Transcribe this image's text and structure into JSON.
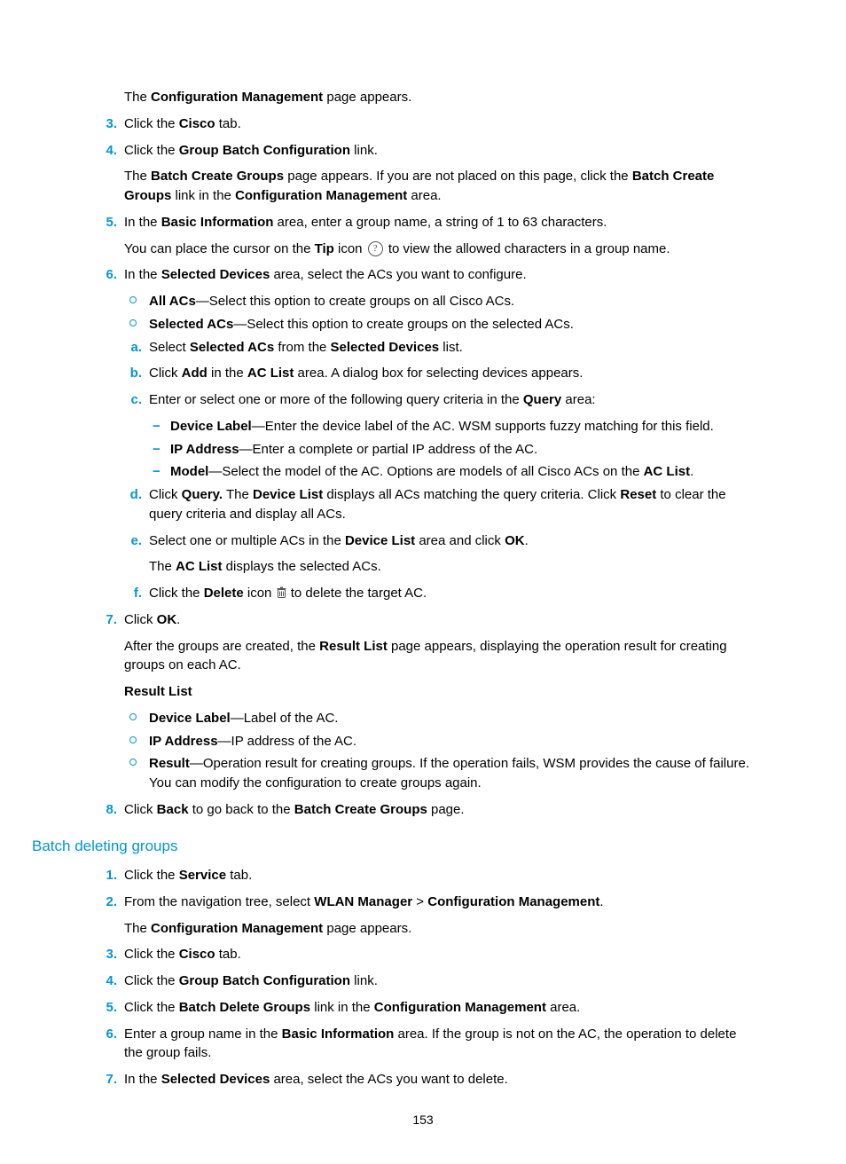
{
  "page_number": "153",
  "sections": {
    "first": {
      "pre_text": {
        "prefix": "The ",
        "bold": "Configuration Management",
        "suffix": " page appears."
      },
      "steps": {
        "3": {
          "line": [
            {
              "t": "Click the "
            },
            {
              "b": "Cisco"
            },
            {
              "t": " tab."
            }
          ]
        },
        "4": {
          "line": [
            {
              "t": "Click the "
            },
            {
              "b": "Group Batch Configuration"
            },
            {
              "t": " link."
            }
          ],
          "para": [
            {
              "t": "The "
            },
            {
              "b": "Batch Create Groups"
            },
            {
              "t": " page appears. If you are not placed on this page, click the "
            },
            {
              "b": "Batch Create Groups"
            },
            {
              "t": " link in the "
            },
            {
              "b": "Configuration Management"
            },
            {
              "t": " area."
            }
          ]
        },
        "5": {
          "line": [
            {
              "t": "In the "
            },
            {
              "b": "Basic Information"
            },
            {
              "t": " area, enter a group name, a string of 1 to 63 characters."
            }
          ],
          "para": [
            {
              "t": "You can place the cursor on the "
            },
            {
              "b": "Tip"
            },
            {
              "t": " icon "
            },
            {
              "icon": "tip"
            },
            {
              "t": " to view the allowed characters in a group name."
            }
          ]
        },
        "6": {
          "line": [
            {
              "t": "In the "
            },
            {
              "b": "Selected Devices"
            },
            {
              "t": " area, select the ACs you want to configure."
            }
          ],
          "circles": [
            [
              {
                "b": "All ACs"
              },
              {
                "t": "—Select this option to create groups on all Cisco ACs."
              }
            ],
            [
              {
                "b": "Selected ACs"
              },
              {
                "t": "—Select this option to create groups on the selected ACs."
              }
            ]
          ],
          "alpha": {
            "a": {
              "line": [
                {
                  "t": "Select "
                },
                {
                  "b": "Selected ACs"
                },
                {
                  "t": " from the "
                },
                {
                  "b": "Selected Devices"
                },
                {
                  "t": " list."
                }
              ]
            },
            "b": {
              "line": [
                {
                  "t": "Click "
                },
                {
                  "b": "Add"
                },
                {
                  "t": " in the "
                },
                {
                  "b": "AC List"
                },
                {
                  "t": " area. A dialog box for selecting devices appears."
                }
              ]
            },
            "c": {
              "line": [
                {
                  "t": "Enter or select one or more of the following query criteria in the "
                },
                {
                  "b": "Query"
                },
                {
                  "t": " area:"
                }
              ],
              "dash": [
                [
                  {
                    "b": "Device Label"
                  },
                  {
                    "t": "—Enter the device label of the AC. WSM supports fuzzy matching for this field."
                  }
                ],
                [
                  {
                    "b": "IP Address"
                  },
                  {
                    "t": "—Enter a complete or partial IP address of the AC."
                  }
                ],
                [
                  {
                    "b": "Model"
                  },
                  {
                    "t": "—Select the model of the AC. Options are models of all Cisco ACs on the "
                  },
                  {
                    "b": "AC List"
                  },
                  {
                    "t": "."
                  }
                ]
              ]
            },
            "d": {
              "line": [
                {
                  "t": "Click "
                },
                {
                  "b": "Query."
                },
                {
                  "t": " The "
                },
                {
                  "b": "Device List"
                },
                {
                  "t": " displays all ACs matching the query criteria. Click "
                },
                {
                  "b": "Reset"
                },
                {
                  "t": " to clear the query criteria and display all ACs."
                }
              ]
            },
            "e": {
              "line": [
                {
                  "t": "Select one or multiple ACs in the "
                },
                {
                  "b": "Device List"
                },
                {
                  "t": " area and click "
                },
                {
                  "b": "OK"
                },
                {
                  "t": "."
                }
              ],
              "para": [
                {
                  "t": "The "
                },
                {
                  "b": "AC List"
                },
                {
                  "t": " displays the selected ACs."
                }
              ]
            },
            "f": {
              "line": [
                {
                  "t": "Click the "
                },
                {
                  "b": "Delete"
                },
                {
                  "t": " icon "
                },
                {
                  "icon": "trash"
                },
                {
                  "t": " to delete the target AC."
                }
              ]
            }
          }
        },
        "7": {
          "line": [
            {
              "t": "Click "
            },
            {
              "b": "OK"
            },
            {
              "t": "."
            }
          ],
          "para": [
            {
              "t": "After the groups are created, the "
            },
            {
              "b": "Result List"
            },
            {
              "t": " page appears, displaying the operation result for creating groups on each AC."
            }
          ],
          "subhead": "Result List",
          "circles": [
            [
              {
                "b": "Device Label"
              },
              {
                "t": "—Label of the AC."
              }
            ],
            [
              {
                "b": "IP Address"
              },
              {
                "t": "—IP address of the AC."
              }
            ],
            [
              {
                "b": "Result"
              },
              {
                "t": "—Operation result for creating groups. If the operation fails, WSM provides the cause of failure. You can modify the configuration to create groups again."
              }
            ]
          ]
        },
        "8": {
          "line": [
            {
              "t": "Click "
            },
            {
              "b": "Back"
            },
            {
              "t": " to go back to the "
            },
            {
              "b": "Batch Create Groups"
            },
            {
              "t": " page."
            }
          ]
        }
      }
    },
    "second": {
      "heading": "Batch deleting groups",
      "steps": {
        "1": {
          "line": [
            {
              "t": "Click the "
            },
            {
              "b": "Service"
            },
            {
              "t": " tab."
            }
          ]
        },
        "2": {
          "line": [
            {
              "t": "From the navigation tree, select "
            },
            {
              "b": "WLAN Manager"
            },
            {
              "t": " > "
            },
            {
              "b": "Configuration Management"
            },
            {
              "t": "."
            }
          ],
          "para": [
            {
              "t": "The "
            },
            {
              "b": "Configuration Management"
            },
            {
              "t": " page appears."
            }
          ]
        },
        "3": {
          "line": [
            {
              "t": "Click the "
            },
            {
              "b": "Cisco"
            },
            {
              "t": " tab."
            }
          ]
        },
        "4": {
          "line": [
            {
              "t": "Click the "
            },
            {
              "b": "Group Batch Configuration"
            },
            {
              "t": " link."
            }
          ]
        },
        "5": {
          "line": [
            {
              "t": "Click the "
            },
            {
              "b": "Batch Delete Groups"
            },
            {
              "t": " link in the "
            },
            {
              "b": "Configuration Management"
            },
            {
              "t": " area."
            }
          ]
        },
        "6": {
          "line": [
            {
              "t": "Enter a group name in the "
            },
            {
              "b": "Basic Information"
            },
            {
              "t": " area. If the group is not on the AC, the operation to delete the group fails."
            }
          ]
        },
        "7": {
          "line": [
            {
              "t": "In the "
            },
            {
              "b": "Selected Devices"
            },
            {
              "t": " area, select the ACs you want to delete."
            }
          ]
        }
      }
    }
  }
}
